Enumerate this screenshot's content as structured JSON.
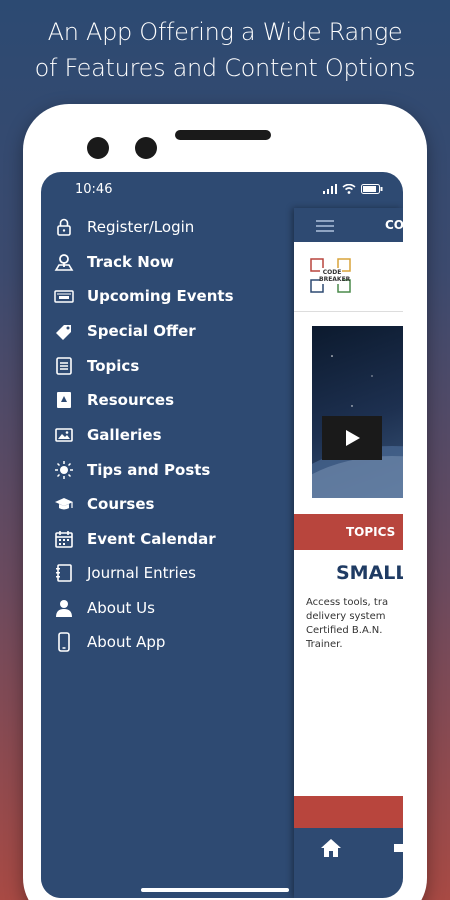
{
  "headline": {
    "line1": "An App Offering a Wide Range",
    "line2": "of Features and Content Options"
  },
  "status_bar": {
    "time": "10:46",
    "icons": [
      "signal-icon",
      "wifi-icon",
      "battery-icon"
    ]
  },
  "drawer": {
    "items": [
      {
        "label": "Register/Login",
        "icon": "lock-icon"
      },
      {
        "label": "Track Now",
        "icon": "map-pin-icon"
      },
      {
        "label": "Upcoming Events",
        "icon": "ticket-icon"
      },
      {
        "label": "Special Offer",
        "icon": "tag-icon"
      },
      {
        "label": "Topics",
        "icon": "list-icon"
      },
      {
        "label": "Resources",
        "icon": "book-icon"
      },
      {
        "label": "Galleries",
        "icon": "image-icon"
      },
      {
        "label": "Tips and Posts",
        "icon": "lightbulb-icon"
      },
      {
        "label": "Courses",
        "icon": "graduation-cap-icon"
      },
      {
        "label": "Event Calendar",
        "icon": "calendar-icon"
      },
      {
        "label": "Journal Entries",
        "icon": "notebook-icon"
      },
      {
        "label": "About Us",
        "icon": "person-icon"
      },
      {
        "label": "About App",
        "icon": "phone-icon"
      }
    ]
  },
  "app": {
    "title": "CO",
    "logo_text": "CODE BREAKER",
    "topics_label": "TOPICS",
    "section_title": "SMALL",
    "description_lines": [
      "Access tools, tra",
      "delivery system",
      "Certified B.A.N.",
      "Trainer."
    ]
  },
  "colors": {
    "primary": "#2e4a72",
    "accent": "#b8453d"
  }
}
